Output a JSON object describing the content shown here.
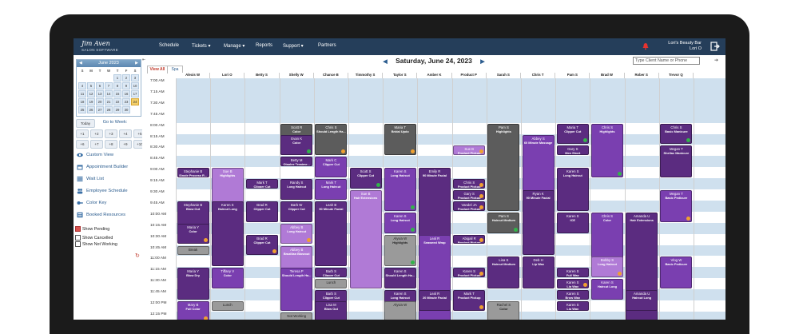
{
  "brand": {
    "script": "Jim Aven",
    "sub": "SALON SOFTWARE"
  },
  "nav": [
    "Schedule",
    "Tickets ▾",
    "Manage ▾",
    "Reports",
    "Support ▾",
    "Partners"
  ],
  "business": {
    "name": "Lori's Beauty Bar",
    "user": "Lori O"
  },
  "calendar": {
    "month": "June 2023",
    "weekdays": [
      "S",
      "M",
      "T",
      "W",
      "T",
      "F",
      "S"
    ],
    "days": [
      "",
      "",
      "",
      "",
      "1",
      "2",
      "3",
      "4",
      "5",
      "6",
      "7",
      "8",
      "9",
      "10",
      "11",
      "12",
      "13",
      "14",
      "15",
      "16",
      "17",
      "18",
      "19",
      "20",
      "21",
      "22",
      "23",
      "24",
      "25",
      "26",
      "27",
      "28",
      "29",
      "30",
      ""
    ],
    "selected": "24"
  },
  "buttons": {
    "today": "Today",
    "goto": "Go to Week:",
    "weeks": [
      "+1",
      "+2",
      "+3",
      "+4",
      "+5",
      "+6",
      "+7",
      "+8",
      "+9",
      "+10"
    ]
  },
  "links": [
    "Custom View",
    "Appointment Builder",
    "Wait List",
    "Employee Schedule",
    "Color Key",
    "Booked Resources"
  ],
  "checks": [
    {
      "label": "Show Pending",
      "on": true
    },
    {
      "label": "Show Cancelled",
      "on": false
    },
    {
      "label": "Show Not Working",
      "on": false
    }
  ],
  "date": "Saturday, June 24, 2023",
  "search_placeholder": "Type Client Name or Phone",
  "tabs": [
    "View All",
    "Spa"
  ],
  "stylists": [
    "Alexis W",
    "Lori O",
    "Betty S",
    "Shelly W",
    "Chance B",
    "Timmothy S",
    "Taylor S",
    "Amber K",
    "Product P",
    "Sarah S",
    "Chris T",
    "Pam S",
    "Brad W",
    "Rober S",
    "Trevor Q"
  ],
  "times": [
    "7:00 AM",
    "7:15 AM",
    "7:30 AM",
    "7:45 AM",
    "8:00 AM",
    "8:15 AM",
    "8:30 AM",
    "8:45 AM",
    "9:00 AM",
    "9:15 AM",
    "9:30 AM",
    "9:45 AM",
    "10:00 AM",
    "10:15 AM",
    "10:30 AM",
    "10:45 AM",
    "11:00 AM",
    "11:15 AM",
    "11:30 AM",
    "11:45 AM",
    "12:00 PM",
    "12:15 PM"
  ],
  "colors": {
    "dark": "#5b2c80",
    "mid": "#7a3fb0",
    "light": "#b07ad6",
    "gray": "#5c5c5c",
    "lgray": "#9a9a9a",
    "green": "#32b34a",
    "orange": "#f0a030"
  },
  "appointments": [
    {
      "col": 3,
      "r": 4,
      "len": 3,
      "name": "Scott R",
      "svc": "Color",
      "c": "gray",
      "dot": "green"
    },
    {
      "col": 4,
      "r": 4,
      "len": 3,
      "name": "Chris S",
      "svc": "Should Length Ha...",
      "c": "gray",
      "dot": "orange"
    },
    {
      "col": 6,
      "r": 4,
      "len": 3,
      "name": "Maria T",
      "svc": "Bridal Updo",
      "c": "gray",
      "dot": "orange"
    },
    {
      "col": 9,
      "r": 4,
      "len": 8,
      "name": "Pam S",
      "svc": "Highlights",
      "c": "gray",
      "dot": ""
    },
    {
      "col": 11,
      "r": 4,
      "len": 2,
      "name": "Maria T",
      "svc": "Clipper Cut",
      "c": "dark",
      "dot": "green"
    },
    {
      "col": 12,
      "r": 4,
      "len": 5,
      "name": "Chris S",
      "svc": "Highlights",
      "c": "mid",
      "dot": "green"
    },
    {
      "col": 14,
      "r": 4,
      "len": 2,
      "name": "Chris S",
      "svc": "Basic Manicure",
      "c": "dark",
      "dot": "green"
    },
    {
      "col": 3,
      "r": 5,
      "len": 2,
      "name": "Evan K",
      "svc": "Color",
      "c": "dark",
      "dot": "green"
    },
    {
      "col": 10,
      "r": 5,
      "len": 6,
      "name": "Abbey S",
      "svc": "60 Minute Massage",
      "c": "mid",
      "dot": "orange"
    },
    {
      "col": 8,
      "r": 6,
      "len": 1,
      "name": "Sue B",
      "svc": "Product Pickup",
      "c": "light",
      "dot": "orange"
    },
    {
      "col": 11,
      "r": 6,
      "len": 1,
      "name": "Gary S",
      "svc": "Men Short",
      "c": "dark",
      "dot": ""
    },
    {
      "col": 14,
      "r": 6,
      "len": 3,
      "name": "Megan T",
      "svc": "Shellac Manicure",
      "c": "dark",
      "dot": ""
    },
    {
      "col": 3,
      "r": 7,
      "len": 1,
      "name": "Betty M",
      "svc": "Olaplex Treatme...",
      "c": "dark",
      "dot": ""
    },
    {
      "col": 4,
      "r": 7,
      "len": 2,
      "name": "Mark C",
      "svc": "Clipper Cut",
      "c": "mid",
      "dot": ""
    },
    {
      "col": 0,
      "r": 8,
      "len": 1,
      "name": "Stephanie B",
      "svc": "Single Process R...",
      "c": "dark",
      "dot": ""
    },
    {
      "col": 1,
      "r": 8,
      "len": 4,
      "name": "Sue B",
      "svc": "Highlights",
      "c": "light",
      "dot": ""
    },
    {
      "col": 5,
      "r": 8,
      "len": 2,
      "name": "Scott S",
      "svc": "Clipper Cut",
      "c": "dark",
      "dot": "green"
    },
    {
      "col": 6,
      "r": 8,
      "len": 4,
      "name": "Karen S",
      "svc": "Long Haircut",
      "c": "mid",
      "dot": "green"
    },
    {
      "col": 7,
      "r": 8,
      "len": 11,
      "name": "Emily R",
      "svc": "90 Minute Facial",
      "c": "dark",
      "dot": ""
    },
    {
      "col": 11,
      "r": 8,
      "len": 4,
      "name": "Karen S",
      "svc": "Long Haircut",
      "c": "dark",
      "dot": ""
    },
    {
      "col": 2,
      "r": 9,
      "len": 1,
      "name": "Mark T",
      "svc": "Clipper Cut",
      "c": "dark",
      "dot": ""
    },
    {
      "col": 3,
      "r": 9,
      "len": 2,
      "name": "Randy S",
      "svc": "Long Haircut",
      "c": "dark",
      "dot": ""
    },
    {
      "col": 4,
      "r": 9,
      "len": 2,
      "name": "Mark T",
      "svc": "Long Haircut",
      "c": "mid",
      "dot": ""
    },
    {
      "col": 8,
      "r": 9,
      "len": 1,
      "name": "Chris S",
      "svc": "Product Pickup",
      "c": "dark",
      "dot": "orange"
    },
    {
      "col": 5,
      "r": 10,
      "len": 9,
      "name": "Sue B",
      "svc": "Hair Extensions",
      "c": "light",
      "dot": ""
    },
    {
      "col": 8,
      "r": 10,
      "len": 1,
      "name": "Gary S",
      "svc": "Product Pickup",
      "c": "dark",
      "dot": "orange"
    },
    {
      "col": 10,
      "r": 10,
      "len": 6,
      "name": "Ryan K",
      "svc": "90 Minute Facial",
      "c": "dark",
      "dot": ""
    },
    {
      "col": 14,
      "r": 10,
      "len": 3,
      "name": "Megan T",
      "svc": "Basic Pedicure",
      "c": "mid",
      "dot": "orange"
    },
    {
      "col": 0,
      "r": 11,
      "len": 3,
      "name": "Stephanie B",
      "svc": "Blow Out",
      "c": "dark",
      "dot": ""
    },
    {
      "col": 1,
      "r": 11,
      "len": 6,
      "name": "Karen S",
      "svc": "Haircut Long",
      "c": "dark",
      "dot": ""
    },
    {
      "col": 2,
      "r": 11,
      "len": 2,
      "name": "Brad R",
      "svc": "Clipper Cut",
      "c": "dark",
      "dot": ""
    },
    {
      "col": 3,
      "r": 11,
      "len": 2,
      "name": "Barb W",
      "svc": "Clipper Cut",
      "c": "dark",
      "dot": ""
    },
    {
      "col": 4,
      "r": 11,
      "len": 6,
      "name": "Leah B",
      "svc": "90 Minute Facial",
      "c": "dark",
      "dot": ""
    },
    {
      "col": 8,
      "r": 11,
      "len": 1,
      "name": "Vandel JA",
      "svc": "Product Pickup",
      "c": "dark",
      "dot": "orange"
    },
    {
      "col": 6,
      "r": 12,
      "len": 2,
      "name": "Karen S",
      "svc": "Long Haircut",
      "c": "mid",
      "dot": "green"
    },
    {
      "col": 9,
      "r": 12,
      "len": 2,
      "name": "Pam S",
      "svc": "Haircut Medium",
      "c": "gray",
      "dot": "green"
    },
    {
      "col": 11,
      "r": 12,
      "len": 2,
      "name": "Karen S",
      "svc": "ICE",
      "c": "dark",
      "dot": ""
    },
    {
      "col": 12,
      "r": 12,
      "len": 5,
      "name": "Chris S",
      "svc": "Color",
      "c": "mid",
      "dot": "green"
    },
    {
      "col": 13,
      "r": 12,
      "len": 11,
      "name": "Amanda U",
      "svc": "Hair Extensions",
      "c": "dark",
      "dot": ""
    },
    {
      "col": 0,
      "r": 13,
      "len": 2,
      "name": "Maria Y",
      "svc": "Color",
      "c": "dark",
      "dot": "orange"
    },
    {
      "col": 3,
      "r": 13,
      "len": 2,
      "name": "Abbey B",
      "svc": "Long Haircut",
      "c": "light",
      "dot": "orange"
    },
    {
      "col": 2,
      "r": 14,
      "len": 2,
      "name": "Brad R",
      "svc": "Clipper Cut",
      "c": "dark",
      "dot": "orange"
    },
    {
      "col": 6,
      "r": 14,
      "len": 3,
      "name": "Alyvia W",
      "svc": "Highlights",
      "c": "lgray",
      "dot": "green"
    },
    {
      "col": 7,
      "r": 14,
      "len": 8,
      "name": "Leal R",
      "svc": "Seaweed Wrap",
      "c": "mid",
      "dot": ""
    },
    {
      "col": 8,
      "r": 14,
      "len": 1,
      "name": "Abigail R",
      "svc": "Product Pickup",
      "c": "dark",
      "dot": "orange"
    },
    {
      "col": 0,
      "r": 15,
      "len": 1,
      "name": "Break",
      "svc": "",
      "c": "lgray",
      "dot": ""
    },
    {
      "col": 3,
      "r": 15,
      "len": 3,
      "name": "Abbey B",
      "svc": "Brazilian Blowout",
      "c": "light",
      "dot": ""
    },
    {
      "col": 9,
      "r": 16,
      "len": 3,
      "name": "Lisa S",
      "svc": "Haircut Medium",
      "c": "dark",
      "dot": ""
    },
    {
      "col": 10,
      "r": 16,
      "len": 3,
      "name": "Deb H",
      "svc": "Lip Wax",
      "c": "dark",
      "dot": ""
    },
    {
      "col": 12,
      "r": 16,
      "len": 2,
      "name": "Bobby S",
      "svc": "Long Haircut",
      "c": "light",
      "dot": "orange"
    },
    {
      "col": 14,
      "r": 16,
      "len": 3,
      "name": "Vlog W",
      "svc": "Basic Pedicure",
      "c": "mid",
      "dot": ""
    },
    {
      "col": 0,
      "r": 17,
      "len": 3,
      "name": "Maria Y",
      "svc": "Blow Dry",
      "c": "dark",
      "dot": ""
    },
    {
      "col": 1,
      "r": 17,
      "len": 2,
      "name": "Tiffany V",
      "svc": "Color",
      "c": "mid",
      "dot": ""
    },
    {
      "col": 3,
      "r": 17,
      "len": 4,
      "name": "Teresa P",
      "svc": "Should Length Ha...",
      "c": "mid",
      "dot": ""
    },
    {
      "col": 4,
      "r": 17,
      "len": 1,
      "name": "Barb S",
      "svc": "Clipper Cut",
      "c": "dark",
      "dot": ""
    },
    {
      "col": 6,
      "r": 17,
      "len": 2,
      "name": "Karen S",
      "svc": "Should Length Ha...",
      "c": "dark",
      "dot": ""
    },
    {
      "col": 8,
      "r": 17,
      "len": 1,
      "name": "Karen S",
      "svc": "Product Pickup",
      "c": "dark",
      "dot": "orange"
    },
    {
      "col": 11,
      "r": 17,
      "len": 1,
      "name": "Karen S",
      "svc": "Full Wax",
      "c": "dark",
      "dot": ""
    },
    {
      "col": 4,
      "r": 18,
      "len": 1,
      "name": "Lunch",
      "svc": "",
      "c": "lgray",
      "dot": ""
    },
    {
      "col": 11,
      "r": 18,
      "len": 1,
      "name": "Karen S",
      "svc": "Lip Wax",
      "c": "dark",
      "dot": "orange"
    },
    {
      "col": 12,
      "r": 18,
      "len": 2,
      "name": "Karen S",
      "svc": "Haircut Long",
      "c": "mid",
      "dot": ""
    },
    {
      "col": 4,
      "r": 19,
      "len": 2,
      "name": "Barb S",
      "svc": "Clipper Cut",
      "c": "dark",
      "dot": ""
    },
    {
      "col": 6,
      "r": 19,
      "len": 2,
      "name": "Karen S",
      "svc": "Long Haircut",
      "c": "dark",
      "dot": "orange"
    },
    {
      "col": 7,
      "r": 19,
      "len": 2,
      "name": "Leal R",
      "svc": "20 Minute Facial",
      "c": "dark",
      "dot": ""
    },
    {
      "col": 8,
      "r": 19,
      "len": 2,
      "name": "Mark T",
      "svc": "Product Pickup",
      "c": "dark",
      "dot": "orange"
    },
    {
      "col": 11,
      "r": 19,
      "len": 1,
      "name": "Karen S",
      "svc": "Brow Wax",
      "c": "dark",
      "dot": ""
    },
    {
      "col": 13,
      "r": 19,
      "len": 2,
      "name": "Amanda U",
      "svc": "Haircut Long",
      "c": "dark",
      "dot": ""
    },
    {
      "col": 0,
      "r": 20,
      "len": 2,
      "name": "Mary B",
      "svc": "Full Color",
      "c": "mid",
      "dot": "orange"
    },
    {
      "col": 1,
      "r": 20,
      "len": 1,
      "name": "Lunch",
      "svc": "",
      "c": "lgray",
      "dot": ""
    },
    {
      "col": 4,
      "r": 20,
      "len": 2,
      "name": "Lisa M",
      "svc": "Blow Out",
      "c": "dark",
      "dot": ""
    },
    {
      "col": 6,
      "r": 20,
      "len": 2,
      "name": "Alyvia W",
      "svc": "",
      "c": "lgray",
      "dot": ""
    },
    {
      "col": 9,
      "r": 20,
      "len": 2,
      "name": "Rachel S",
      "svc": "Color",
      "c": "lgray",
      "dot": ""
    },
    {
      "col": 11,
      "r": 20,
      "len": 1,
      "name": "Karen S",
      "svc": "Lip Wax",
      "c": "dark",
      "dot": ""
    },
    {
      "col": 3,
      "r": 21,
      "len": 1,
      "name": "Not Working",
      "svc": "",
      "c": "lgray",
      "dot": ""
    }
  ]
}
